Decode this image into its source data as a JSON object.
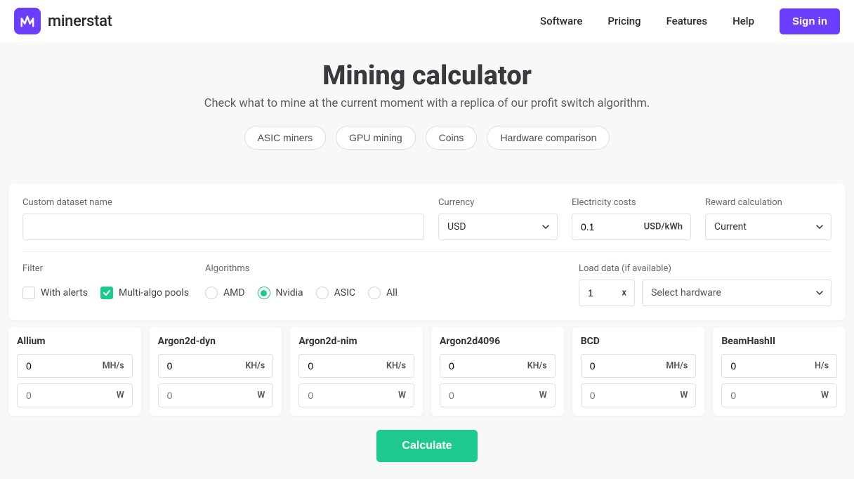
{
  "brand": {
    "name": "minerstat"
  },
  "nav": {
    "software": "Software",
    "pricing": "Pricing",
    "features": "Features",
    "help": "Help",
    "signin": "Sign in"
  },
  "hero": {
    "title": "Mining calculator",
    "subtitle": "Check what to mine at the current moment with a replica of our profit switch algorithm.",
    "pills": {
      "asic": "ASIC miners",
      "gpu": "GPU mining",
      "coins": "Coins",
      "compare": "Hardware comparison"
    }
  },
  "form": {
    "dataset": {
      "label": "Custom dataset name",
      "value": ""
    },
    "currency": {
      "label": "Currency",
      "value": "USD"
    },
    "cost": {
      "label": "Electricity costs",
      "value": "0.1",
      "unit": "USD/kWh"
    },
    "reward": {
      "label": "Reward calculation",
      "value": "Current"
    },
    "filter": {
      "label": "Filter",
      "with_alerts": "With alerts",
      "multi_algo": "Multi-algo pools",
      "with_alerts_checked": false,
      "multi_algo_checked": true
    },
    "algorithms": {
      "label": "Algorithms",
      "amd": "AMD",
      "nvidia": "Nvidia",
      "asic": "ASIC",
      "all": "All",
      "selected": "nvidia"
    },
    "load": {
      "label": "Load data (if available)",
      "value": "1",
      "suffix": "x"
    },
    "hardware": {
      "placeholder": "Select hardware"
    }
  },
  "algo_cards": [
    {
      "name": "Allium",
      "hash": "0",
      "hash_unit": "MH/s",
      "power_placeholder": "0",
      "power_unit": "W"
    },
    {
      "name": "Argon2d-dyn",
      "hash": "0",
      "hash_unit": "KH/s",
      "power_placeholder": "0",
      "power_unit": "W"
    },
    {
      "name": "Argon2d-nim",
      "hash": "0",
      "hash_unit": "KH/s",
      "power_placeholder": "0",
      "power_unit": "W"
    },
    {
      "name": "Argon2d4096",
      "hash": "0",
      "hash_unit": "KH/s",
      "power_placeholder": "0",
      "power_unit": "W"
    },
    {
      "name": "BCD",
      "hash": "0",
      "hash_unit": "MH/s",
      "power_placeholder": "0",
      "power_unit": "W"
    },
    {
      "name": "BeamHashII",
      "hash": "0",
      "hash_unit": "H/s",
      "power_placeholder": "0",
      "power_unit": "W"
    }
  ],
  "calculate": "Calculate"
}
